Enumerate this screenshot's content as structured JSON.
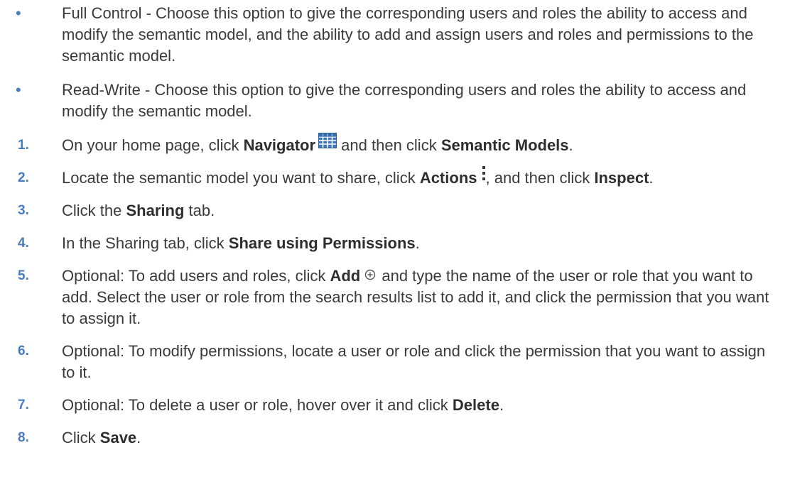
{
  "bullets": [
    {
      "text": "Full Control - Choose this option to give the corresponding users and roles the ability to access and modify the semantic model, and the ability to add and assign users and roles and permissions to the semantic model."
    },
    {
      "text": "Read-Write - Choose this option to give the corresponding users and roles the ability to access and modify the semantic model."
    }
  ],
  "steps": [
    {
      "number": "1.",
      "t1": "On your home page, click ",
      "b1": "Navigator",
      "t2": " and then click ",
      "b2": "Semantic Models",
      "t3": ".",
      "icon": "navigator-grid-icon"
    },
    {
      "number": "2.",
      "t1": "Locate the semantic model you want to share, click ",
      "b1": "Actions",
      "t2": ", and then click ",
      "b2": "Inspect",
      "t3": ".",
      "icon": "actions-kebab-icon"
    },
    {
      "number": "3.",
      "t1": "Click the ",
      "b1": "Sharing",
      "t2": " tab."
    },
    {
      "number": "4.",
      "t1": "In the Sharing tab, click ",
      "b1": "Share using Permissions",
      "t2": "."
    },
    {
      "number": "5.",
      "t1": "Optional: To add users and roles, click ",
      "b1": "Add",
      "t2": " and type the name of the user or role that you want to add. Select the user or role from the search results list to add it, and click the permission that you want to assign it.",
      "icon": "add-circle-icon"
    },
    {
      "number": "6.",
      "t1": "Optional: To modify permissions, locate a user or role and click the permission that you want to assign to it."
    },
    {
      "number": "7.",
      "t1": "Optional: To delete a user or role, hover over it and click ",
      "b1": "Delete",
      "t2": "."
    },
    {
      "number": "8.",
      "t1": "Click ",
      "b1": "Save",
      "t2": "."
    }
  ],
  "colors": {
    "accent": "#4a7dbd",
    "text": "#3a3a3a"
  }
}
